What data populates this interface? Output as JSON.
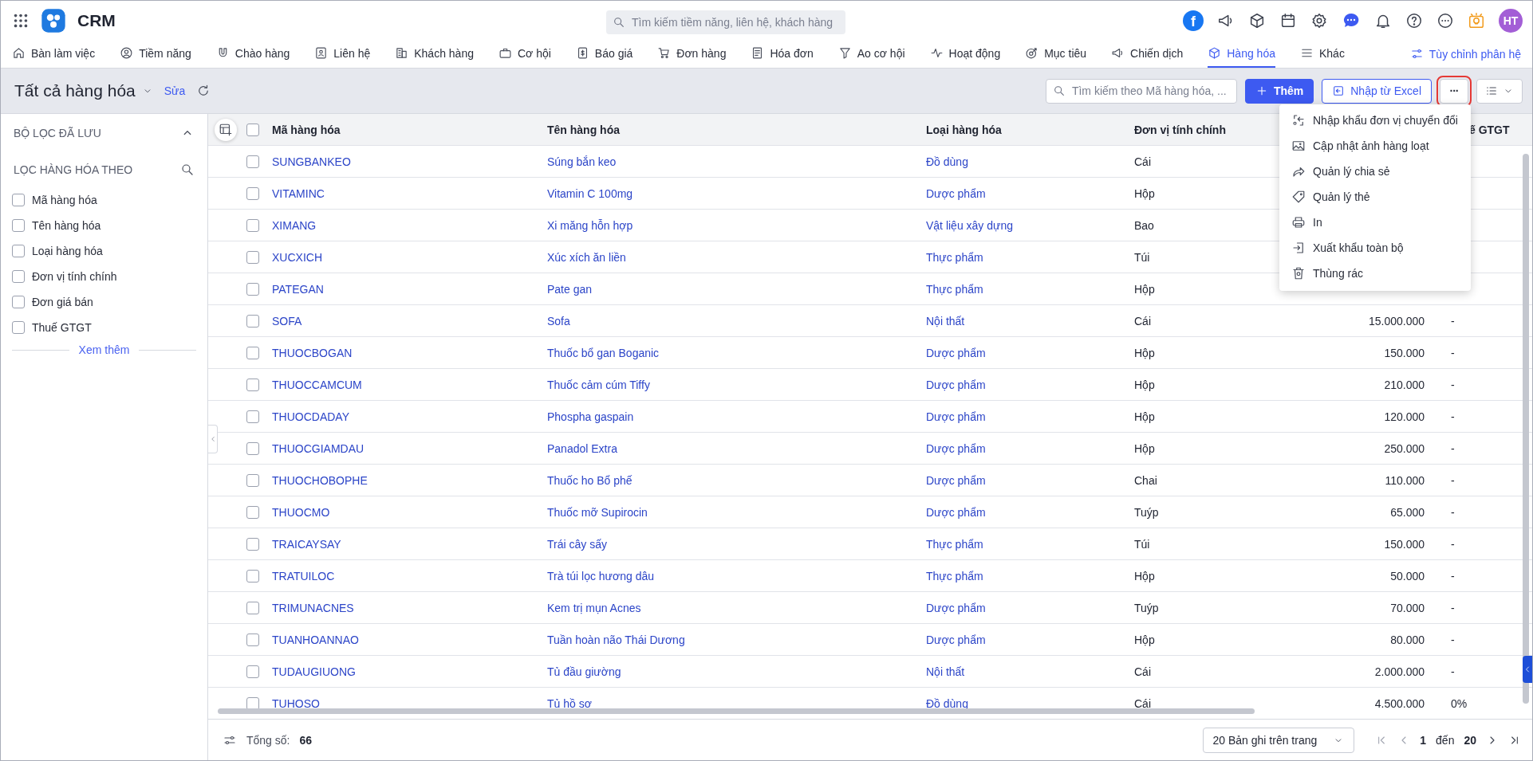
{
  "app": {
    "title": "CRM",
    "search_placeholder": "Tìm kiếm tiềm năng, liên hệ, khách hàng",
    "fb_glyph": "f",
    "avatar": "HT"
  },
  "nav": [
    {
      "label": "Bàn làm việc",
      "selected": false
    },
    {
      "label": "Tiềm năng",
      "selected": false
    },
    {
      "label": "Chào hàng",
      "selected": false
    },
    {
      "label": "Liên hệ",
      "selected": false
    },
    {
      "label": "Khách hàng",
      "selected": false
    },
    {
      "label": "Cơ hội",
      "selected": false
    },
    {
      "label": "Báo giá",
      "selected": false
    },
    {
      "label": "Đơn hàng",
      "selected": false
    },
    {
      "label": "Hóa đơn",
      "selected": false
    },
    {
      "label": "Ao cơ hội",
      "selected": false
    },
    {
      "label": "Hoạt động",
      "selected": false
    },
    {
      "label": "Mục tiêu",
      "selected": false
    },
    {
      "label": "Chiến dịch",
      "selected": false
    },
    {
      "label": "Hàng hóa",
      "selected": true
    },
    {
      "label": "Khác",
      "selected": false
    }
  ],
  "customize": "Tùy chỉnh phân hệ",
  "toolbar": {
    "view_title": "Tất cả hàng hóa",
    "edit_link": "Sửa",
    "search_placeholder": "Tìm kiếm theo Mã hàng hóa, ...",
    "add_button": "Thêm",
    "import_button": "Nhập từ Excel",
    "more_button": {
      "glyph": "···",
      "highlighted": true
    }
  },
  "more_menu": {
    "open": true,
    "items": [
      "Nhập khẩu đơn vị chuyển đổi",
      "Cập nhật ảnh hàng loạt",
      "Quản lý chia sẻ",
      "Quản lý thẻ",
      "In",
      "Xuất khẩu toàn bộ",
      "Thùng rác"
    ]
  },
  "sidebar": {
    "saved_filters": {
      "title": "BỘ LỌC ĐÃ LƯU",
      "expanded": true
    },
    "filter_title": "LỌC HÀNG HÓA THEO",
    "filters": [
      {
        "label": "Mã hàng hóa",
        "checked": false
      },
      {
        "label": "Tên hàng hóa",
        "checked": false
      },
      {
        "label": "Loại hàng hóa",
        "checked": false
      },
      {
        "label": "Đơn vị tính chính",
        "checked": false
      },
      {
        "label": "Đơn giá bán",
        "checked": false
      },
      {
        "label": "Thuế GTGT",
        "checked": false
      }
    ],
    "more_link": "Xem thêm"
  },
  "table": {
    "select_all": false,
    "columns": [
      "Mã hàng hóa",
      "Tên hàng hóa",
      "Loại hàng hóa",
      "Đơn vị tính chính",
      "ế GTGT"
    ],
    "rows": [
      {
        "checked": false,
        "code": "SUNGBANKEO",
        "name": "Súng bắn keo",
        "type": "Đồ dùng",
        "unit": "Cái"
      },
      {
        "checked": false,
        "code": "VITAMINC",
        "name": "Vitamin C 100mg",
        "type": "Dược phẩm",
        "unit": "Hộp"
      },
      {
        "checked": false,
        "code": "XIMANG",
        "name": "Xi măng hỗn hợp",
        "type": "Vật liệu xây dựng",
        "unit": "Bao"
      },
      {
        "checked": false,
        "code": "XUCXICH",
        "name": "Xúc xích ăn liền",
        "type": "Thực phẩm",
        "unit": "Túi"
      },
      {
        "checked": false,
        "code": "PATEGAN",
        "name": "Pate gan",
        "type": "Thực phẩm",
        "unit": "Hộp"
      },
      {
        "checked": false,
        "code": "SOFA",
        "name": "Sofa",
        "type": "Nội thất",
        "unit": "Cái",
        "price": "15.000.000",
        "tax": "-"
      },
      {
        "checked": false,
        "code": "THUOCBOGAN",
        "name": "Thuốc bổ gan Boganic",
        "type": "Dược phẩm",
        "unit": "Hộp",
        "price": "150.000",
        "tax": "-"
      },
      {
        "checked": false,
        "code": "THUOCCAMCUM",
        "name": "Thuốc cảm cúm Tiffy",
        "type": "Dược phẩm",
        "unit": "Hộp",
        "price": "210.000",
        "tax": "-"
      },
      {
        "checked": false,
        "code": "THUOCDADAY",
        "name": "Phospha gaspain",
        "type": "Dược phẩm",
        "unit": "Hộp",
        "price": "120.000",
        "tax": "-"
      },
      {
        "checked": false,
        "code": "THUOCGIAMDAU",
        "name": "Panadol Extra",
        "type": "Dược phẩm",
        "unit": "Hộp",
        "price": "250.000",
        "tax": "-"
      },
      {
        "checked": false,
        "code": "THUOCHOBOPHE",
        "name": "Thuốc ho Bổ phế",
        "type": "Dược phẩm",
        "unit": "Chai",
        "price": "110.000",
        "tax": "-"
      },
      {
        "checked": false,
        "code": "THUOCMO",
        "name": "Thuốc mỡ Supirocin",
        "type": "Dược phẩm",
        "unit": "Tuýp",
        "price": "65.000",
        "tax": "-"
      },
      {
        "checked": false,
        "code": "TRAICAYSAY",
        "name": "Trái cây sấy",
        "type": "Thực phẩm",
        "unit": "Túi",
        "price": "150.000",
        "tax": "-"
      },
      {
        "checked": false,
        "code": "TRATUILOC",
        "name": "Trà túi lọc hương dâu",
        "type": "Thực phẩm",
        "unit": "Hộp",
        "price": "50.000",
        "tax": "-"
      },
      {
        "checked": false,
        "code": "TRIMUNACNES",
        "name": "Kem trị mụn Acnes",
        "type": "Dược phẩm",
        "unit": "Tuýp",
        "price": "70.000",
        "tax": "-"
      },
      {
        "checked": false,
        "code": "TUANHOANNAO",
        "name": "Tuần hoàn não Thái Dương",
        "type": "Dược phẩm",
        "unit": "Hộp",
        "price": "80.000",
        "tax": "-"
      },
      {
        "checked": false,
        "code": "TUDAUGIUONG",
        "name": "Tủ đầu giường",
        "type": "Nội thất",
        "unit": "Cái",
        "price": "2.000.000",
        "tax": "-"
      },
      {
        "checked": false,
        "code": "TUHOSO",
        "name": "Tủ hồ sơ",
        "type": "Đồ dùng",
        "unit": "Cái",
        "price": "4.500.000",
        "tax": "0%"
      }
    ]
  },
  "footer": {
    "total_label": "Tổng số:",
    "total": "66",
    "page_size": "20 Bản ghi trên trang",
    "page_from": "1",
    "page_to_label": "đến",
    "page_to": "20"
  }
}
